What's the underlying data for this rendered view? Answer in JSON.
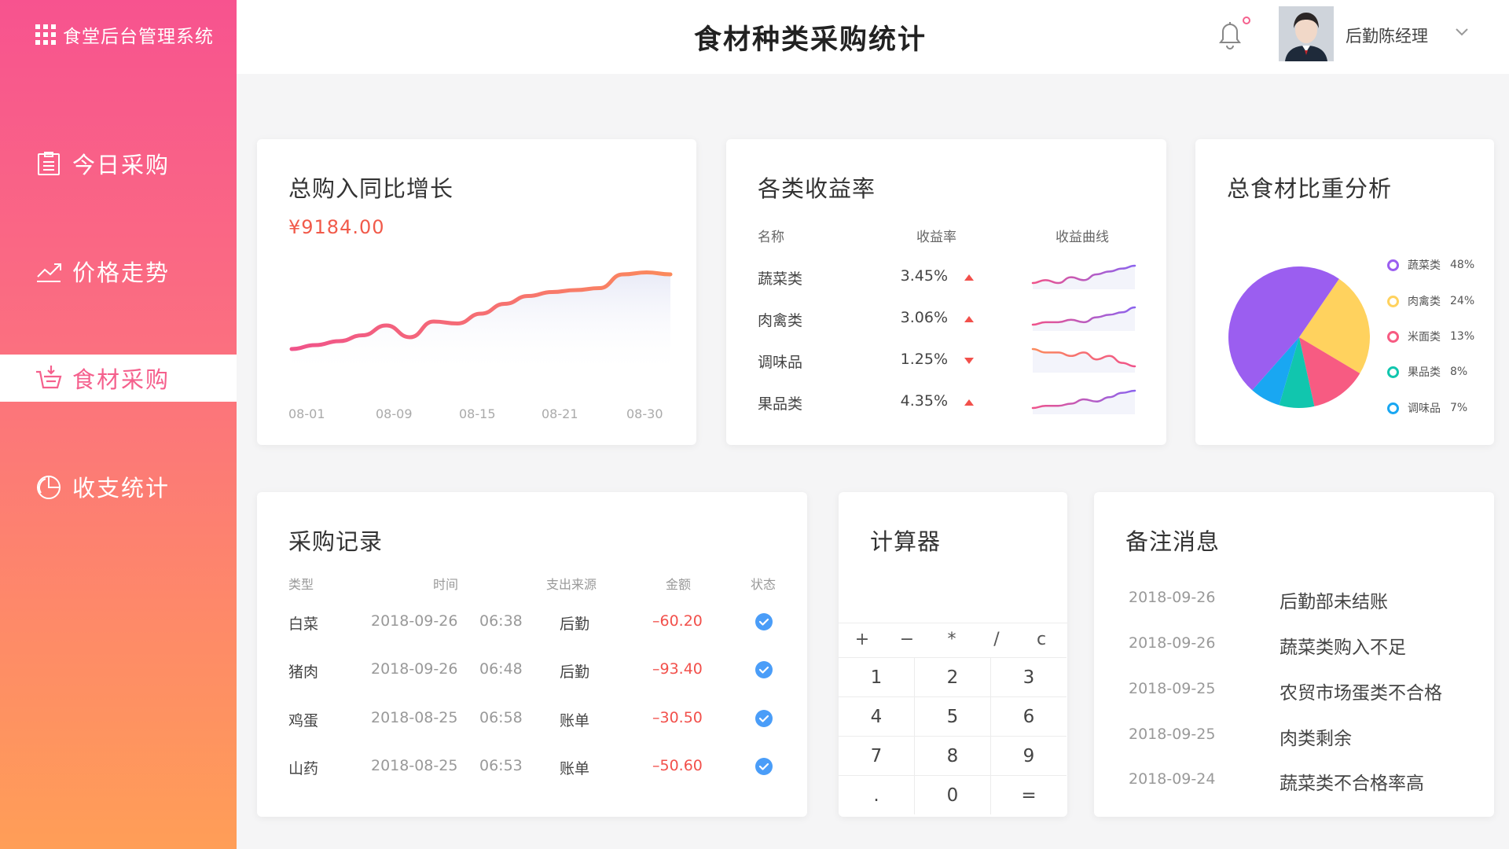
{
  "sidebar": {
    "brand": "食堂后台管理系统",
    "items": [
      {
        "label": "今日采购",
        "icon": "clipboard-icon"
      },
      {
        "label": "价格走势",
        "icon": "trend-chart-icon"
      },
      {
        "label": "食材采购",
        "icon": "basket-icon",
        "active": true
      },
      {
        "label": "收支统计",
        "icon": "pie-chart-icon"
      }
    ]
  },
  "header": {
    "title": "食材种类采购统计",
    "user_name": "后勤陈经理"
  },
  "growth_card": {
    "title": "总购入同比增长",
    "amount": "¥9184.00",
    "chart_data": {
      "type": "area",
      "x": [
        "08-01",
        "08-09",
        "08-15",
        "08-21",
        "08-30"
      ],
      "ticks": [
        "08-01",
        "08-09",
        "08-15",
        "08-21",
        "08-30"
      ],
      "values": [
        10,
        12,
        14,
        17,
        22,
        16,
        24,
        23,
        28,
        33,
        37,
        39,
        40,
        41,
        48,
        49,
        48
      ],
      "ylim": [
        0,
        60
      ]
    }
  },
  "yield_card": {
    "title": "各类收益率",
    "headers": {
      "name": "名称",
      "rate": "收益率",
      "curve": "收益曲线"
    },
    "rows": [
      {
        "name": "蔬菜类",
        "rate": "3.45%",
        "trend": "up",
        "curve": [
          3,
          4,
          3,
          5,
          4,
          6,
          7,
          8,
          9
        ]
      },
      {
        "name": "肉禽类",
        "rate": "3.06%",
        "trend": "up",
        "curve": [
          2,
          3,
          3,
          4,
          3,
          5,
          6,
          7,
          9
        ]
      },
      {
        "name": "调味品",
        "rate": "1.25%",
        "trend": "down",
        "curve": [
          9,
          8,
          8,
          7,
          8,
          6,
          7,
          5,
          4
        ]
      },
      {
        "name": "果品类",
        "rate": "4.35%",
        "trend": "up",
        "curve": [
          1,
          2,
          2,
          3,
          5,
          4,
          6,
          8,
          9
        ]
      }
    ]
  },
  "share_card": {
    "title": "总食材比重分析",
    "chart_data": {
      "type": "pie",
      "slices": [
        {
          "name": "蔬菜类",
          "value": 48,
          "label": "48%",
          "color": "#9b5ef0"
        },
        {
          "name": "肉禽类",
          "value": 24,
          "label": "24%",
          "color": "#ffd25e"
        },
        {
          "name": "米面类",
          "value": 13,
          "label": "13%",
          "color": "#f75b82"
        },
        {
          "name": "果品类",
          "value": 8,
          "label": "8%",
          "color": "#11c6ae"
        },
        {
          "name": "调味品",
          "value": 7,
          "label": "7%",
          "color": "#19a7f2"
        }
      ]
    }
  },
  "records": {
    "title": "采购记录",
    "headers": {
      "type": "类型",
      "time": "时间",
      "source": "支出来源",
      "amount": "金额",
      "status": "状态"
    },
    "rows": [
      {
        "type": "白菜",
        "date": "2018-09-26",
        "time": "06:38",
        "source": "后勤",
        "amount": "–60.20"
      },
      {
        "type": "猪肉",
        "date": "2018-09-26",
        "time": "06:48",
        "source": "后勤",
        "amount": "–93.40"
      },
      {
        "type": "鸡蛋",
        "date": "2018-08-25",
        "time": "06:58",
        "source": "账单",
        "amount": "–30.50"
      },
      {
        "type": "山药",
        "date": "2018-08-25",
        "time": "06:53",
        "source": "账单",
        "amount": "–50.60"
      }
    ]
  },
  "calculator": {
    "title": "计算器",
    "ops": [
      "+",
      "−",
      "*",
      "/",
      "c"
    ],
    "keys": [
      "1",
      "2",
      "3",
      "4",
      "5",
      "6",
      "7",
      "8",
      "9",
      ".",
      "0",
      "="
    ]
  },
  "notes": {
    "title": "备注消息",
    "items": [
      {
        "date": "2018-09-26",
        "text": "后勤部未结账"
      },
      {
        "date": "2018-09-26",
        "text": "蔬菜类购入不足"
      },
      {
        "date": "2018-09-25",
        "text": "农贸市场蛋类不合格"
      },
      {
        "date": "2018-09-25",
        "text": "肉类剩余"
      },
      {
        "date": "2018-09-24",
        "text": "蔬菜类不合格率高"
      }
    ]
  },
  "colors": {
    "accent": "#f5608d",
    "negative": "#f2504b",
    "check": "#4a9df8"
  }
}
